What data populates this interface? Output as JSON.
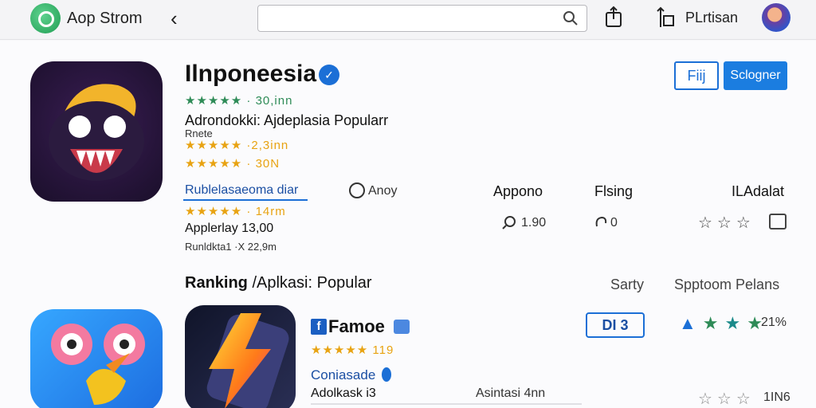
{
  "topbar": {
    "store_name": "Aop Strom",
    "back_glyph": "‹",
    "search_placeholder": "",
    "publish_label": "PLrtisan"
  },
  "app1": {
    "title": "Ilnponeesia",
    "rating_line": "★★★★★ · 30,inn",
    "subtitle": "Adrondokki: Ajdeplasia Popularr",
    "note": "Rnete",
    "rating2": "★★★★★ ·2,3inn",
    "rating3": "★★★★★ · 30N",
    "open_label": "Fiij",
    "select_label": "Sclogner"
  },
  "details": {
    "link_label": "Rublelasaeoma diar",
    "radio_label": "Anoy",
    "col1": "Appono",
    "col2": "Flsing",
    "col3": "ILAdalat",
    "rating_line": "★★★★★ · 14rm",
    "updated": "Applerlay 13,00",
    "count1": "1.90",
    "count2": "0",
    "footer": "Runldkta1 ·X 22,9m"
  },
  "section": {
    "title": "Ranking",
    "title_rest": "/Aplkasi: Popular",
    "sort": "Sarty",
    "spptoom": "Spptoom Pelans"
  },
  "app2": {
    "title": "Famoe",
    "rating": "★★★★★ 119",
    "blue_text": "Coniasade",
    "dev": "Adolkask  i3",
    "right_text": "Asintasi 4nn",
    "code": "DI 3",
    "rating_value": "21%",
    "rating2_value": "1IN6"
  }
}
